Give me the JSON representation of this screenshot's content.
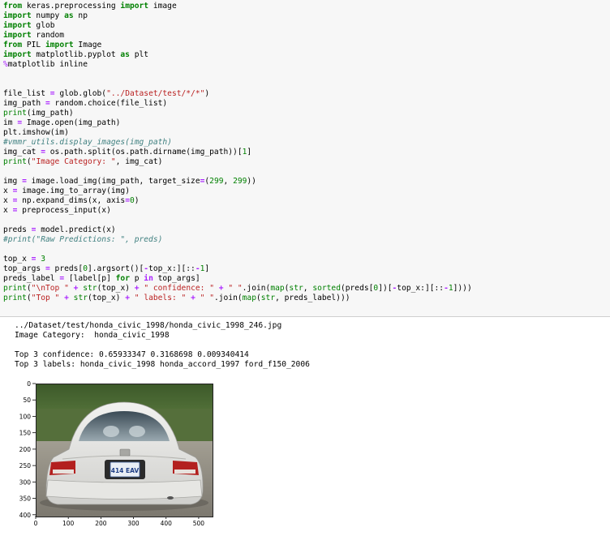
{
  "code_cell": {
    "lines": [
      "from keras.preprocessing import image",
      "import numpy as np",
      "import glob",
      "import random",
      "from PIL import Image",
      "import matplotlib.pyplot as plt",
      "%matplotlib inline",
      "",
      "",
      "file_list = glob.glob(\"../Dataset/test/*/*\")",
      "img_path = random.choice(file_list)",
      "print(img_path)",
      "im = Image.open(img_path)",
      "plt.imshow(im)",
      "#vmmr_utils.display_images(img_path)",
      "img_cat = os.path.split(os.path.dirname(img_path))[1]",
      "print(\"Image Category: \", img_cat)",
      "",
      "img = image.load_img(img_path, target_size=(299, 299))",
      "x = image.img_to_array(img)",
      "x = np.expand_dims(x, axis=0)",
      "x = preprocess_input(x)",
      "",
      "preds = model.predict(x)",
      "#print(\"Raw Predictions: \", preds)",
      "",
      "top_x = 3",
      "top_args = preds[0].argsort()[-top_x:][::-1]",
      "preds_label = [label[p] for p in top_args]",
      "print(\"\\nTop \" + str(top_x) + \" confidence: \" + \" \".join(map(str, sorted(preds[0])[-top_x:][::-1])))",
      "print(\"Top \" + str(top_x) + \" labels: \" + \" \".join(map(str, preds_label)))"
    ]
  },
  "output": {
    "line1": "../Dataset/test/honda_civic_1998/honda_civic_1998_246.jpg",
    "line2": "Image Category:  honda_civic_1998",
    "line3": "",
    "line4": "Top 3 confidence: 0.65933347 0.3168698 0.009340414",
    "line5": "Top 3 labels: honda_civic_1998 honda_accord_1997 ford_f150_2006"
  },
  "plot": {
    "y_ticks": [
      "0",
      "50",
      "100",
      "150",
      "200",
      "250",
      "300",
      "350",
      "400"
    ],
    "x_ticks": [
      "0",
      "100",
      "200",
      "300",
      "400",
      "500"
    ],
    "plate_text": "414 EAV",
    "colors": {
      "car_body": "#e8e8e6",
      "foliage": "#4f6a35",
      "ground": "#8f8b80",
      "plate": "#e9eef5"
    }
  }
}
